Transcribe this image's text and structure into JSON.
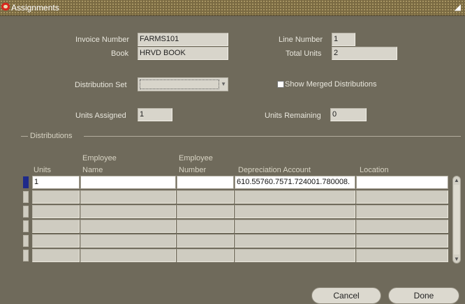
{
  "window": {
    "title": "Assignments",
    "resize_glyph": "◢"
  },
  "header": {
    "invoice_number_label": "Invoice Number",
    "invoice_number_value": "FARMS101",
    "book_label": "Book",
    "book_value": "HRVD BOOK",
    "line_number_label": "Line Number",
    "line_number_value": "1",
    "total_units_label": "Total Units",
    "total_units_value": "2",
    "distribution_set_label": "Distribution Set",
    "distribution_set_value": "",
    "show_merged_label": "Show Merged Distributions",
    "show_merged_checked": false,
    "units_assigned_label": "Units Assigned",
    "units_assigned_value": "1",
    "units_remaining_label": "Units Remaining",
    "units_remaining_value": "0"
  },
  "distributions": {
    "section_label": "Distributions",
    "columns": {
      "units": "Units",
      "employee_name_1": "Employee",
      "employee_name_2": "Name",
      "employee_number_1": "Employee",
      "employee_number_2": "Number",
      "depreciation_account": "Depreciation Account",
      "location": "Location"
    },
    "rows": [
      {
        "units": "1",
        "employee_name": "",
        "employee_number": "",
        "depreciation_account": "610.55760.7571.724001.780008.",
        "location": ""
      },
      {
        "units": "",
        "employee_name": "",
        "employee_number": "",
        "depreciation_account": "",
        "location": ""
      },
      {
        "units": "",
        "employee_name": "",
        "employee_number": "",
        "depreciation_account": "",
        "location": ""
      },
      {
        "units": "",
        "employee_name": "",
        "employee_number": "",
        "depreciation_account": "",
        "location": ""
      },
      {
        "units": "",
        "employee_name": "",
        "employee_number": "",
        "depreciation_account": "",
        "location": ""
      },
      {
        "units": "",
        "employee_name": "",
        "employee_number": "",
        "depreciation_account": "",
        "location": ""
      }
    ]
  },
  "buttons": {
    "cancel": "Cancel",
    "done": "Done"
  }
}
